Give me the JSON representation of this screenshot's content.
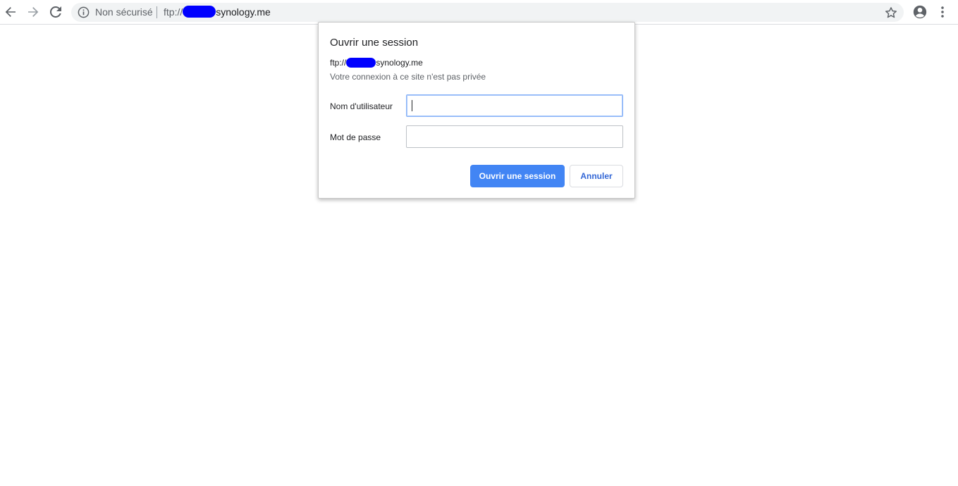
{
  "browser": {
    "nav": {
      "back_icon": "arrow-left-icon",
      "forward_icon": "arrow-right-icon",
      "reload_icon": "reload-icon"
    },
    "omnibox": {
      "security_icon": "info-circle-icon",
      "security_label": "Non sécurisé",
      "url_scheme": "ftp://",
      "url_host_suffix": "synology.me",
      "bookmark_icon": "star-outline-icon"
    },
    "profile_icon": "account-circle-icon",
    "menu_icon": "kebab-menu-icon"
  },
  "dialog": {
    "title": "Ouvrir une session",
    "origin_scheme": "ftp://",
    "origin_suffix": "synology.me",
    "warning": "Votre connexion à ce site n'est pas privée",
    "username": {
      "label": "Nom d'utilisateur",
      "value": ""
    },
    "password": {
      "label": "Mot de passe",
      "value": ""
    },
    "sign_in_label": "Ouvrir une session",
    "cancel_label": "Annuler"
  },
  "colors": {
    "primary_button": "#4285f4",
    "redaction": "#0000ff",
    "link_text": "#3367d6"
  }
}
